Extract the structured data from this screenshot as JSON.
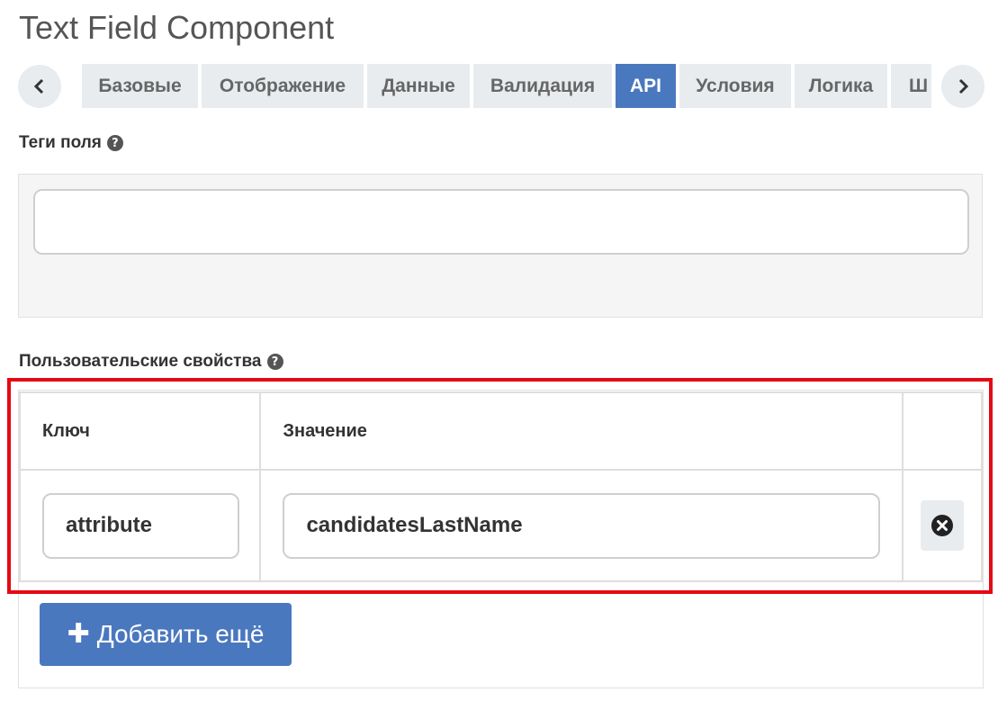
{
  "page": {
    "title": "Text Field Component"
  },
  "tabs": [
    {
      "label": "Базовые"
    },
    {
      "label": "Отображение"
    },
    {
      "label": "Данные"
    },
    {
      "label": "Валидация"
    },
    {
      "label": "API",
      "active": true
    },
    {
      "label": "Условия"
    },
    {
      "label": "Логика"
    },
    {
      "label": "Ш"
    }
  ],
  "nav": {
    "prev_icon": "chevron-left-icon",
    "next_icon": "chevron-right-icon"
  },
  "tags_section": {
    "label": "Теги поля",
    "input_value": "",
    "help_icon": "question-circle-icon"
  },
  "custom_props": {
    "label": "Пользовательские свойства",
    "help_icon": "question-circle-icon",
    "columns": [
      "Ключ",
      "Значение",
      ""
    ],
    "rows": [
      {
        "key": "attribute",
        "value": "candidatesLastName"
      }
    ],
    "add_button_label": "Добавить ещё"
  },
  "colors": {
    "accent": "#4a78bf",
    "highlight": "#e50914",
    "tab_bg": "#e8ecef"
  }
}
